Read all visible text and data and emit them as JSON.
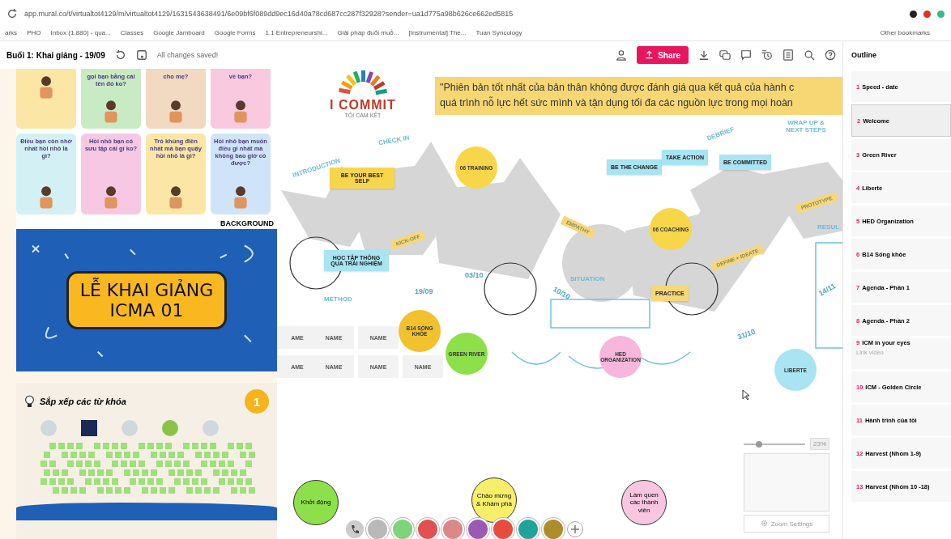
{
  "browser": {
    "url": "app.mural.co/t/virtualtot4129/m/virtualtot4129/1631543638491/6e09bf6f089dd9ec16d40a78cd687cc287f32928?sender=ua1d775a98b626ce662ed5815",
    "bookmarks": [
      "arks",
      "PHO",
      "Inbox (1,880) - qua...",
      "Classes",
      "Google Jamboard",
      "Google Forms",
      "1.1 Entrepreneurshi...",
      "Giải pháp đuổi muỗ...",
      "[Instrumental] The...",
      "Tuan Syncology"
    ],
    "other_bookmarks": "Other bookmarks"
  },
  "toolbar": {
    "title": "Buổi 1: Khai giảng - 19/09",
    "status": "All changes saved!",
    "share": "Share"
  },
  "outline": {
    "title": "Outline",
    "items": [
      {
        "number": "1",
        "label": "Speed - date",
        "selected": false
      },
      {
        "number": "2",
        "label": "Welcome",
        "selected": true
      },
      {
        "number": "3",
        "label": "Green River",
        "selected": false
      },
      {
        "number": "4",
        "label": "Liberte",
        "selected": false
      },
      {
        "number": "5",
        "label": "HED Organization",
        "selected": false
      },
      {
        "number": "6",
        "label": "B14 Sống khỏe",
        "selected": false
      },
      {
        "number": "7",
        "label": "Agenda - Phần 1",
        "selected": false
      },
      {
        "number": "8",
        "label": "Agenda - Phần 2",
        "selected": false
      },
      {
        "number": "9",
        "label": "ICM in your eyes",
        "note": "Link video",
        "selected": false
      },
      {
        "number": "10",
        "label": "ICM - Golden Circle",
        "selected": false
      },
      {
        "number": "11",
        "label": "Hành trình của tôi",
        "selected": false
      },
      {
        "number": "12",
        "label": "Harvest (Nhóm 1-9)",
        "selected": false
      },
      {
        "number": "13",
        "label": "Harvest (Nhóm 10 -18)",
        "selected": false
      }
    ]
  },
  "question_cards": [
    {
      "color": "#fbe6a6"
    },
    {
      "text": "gọi bạn bằng cái tên đó ko?",
      "color": "#c9ebc4"
    },
    {
      "text": "cho mẹ?",
      "color": "#f1d9c2"
    },
    {
      "text": "về bạn?",
      "color": "#f9c9e0"
    },
    {
      "text": "Điều bạn còn nhớ nhất hồi nhỏ là gì?",
      "color": "#d3f1f5"
    },
    {
      "text": "Hồi nhỏ bạn có sưu tập cái gì ko?",
      "color": "#f7c8e4"
    },
    {
      "text": "Trò khùng điên nhất mà bạn quậy hồi nhỏ là gì?",
      "color": "#fbe6a6"
    },
    {
      "text": "Hồi nhỏ bạn muốn điều gì nhất mà không bao giờ có được?",
      "color": "#cfe4f8"
    }
  ],
  "background_label": "BACKGROUND",
  "banner": {
    "line1": "LỄ KHAI GIẢNG",
    "line2": "ICMA 01"
  },
  "keywords_card": {
    "title": "Sắp xếp các từ khóa",
    "badge": "1"
  },
  "canvas": {
    "logo": {
      "name": "I COMMIT",
      "subtitle": "TÔI CAM KẾT"
    },
    "quote": [
      "\"Phiên bản tốt nhất của bản thân không được đánh giá qua kết quả của hành c",
      "quá trình nỗ lực hết sức mình và tận dụng tối đa các nguồn lực trong mọi hoàn"
    ],
    "items": [
      {
        "kind": "label",
        "text": "INTRODUCTION"
      },
      {
        "kind": "label",
        "text": "CHECK IN"
      },
      {
        "kind": "sticky",
        "text": "BE YOUR BEST SELF",
        "color": "#f7d64a"
      },
      {
        "kind": "circle",
        "text": "06 TRAINING",
        "color": "#f7d64a"
      },
      {
        "kind": "sticky",
        "text": "BE THE CHANGE",
        "color": "#a8e4f2"
      },
      {
        "kind": "sticky",
        "text": "TAKE ACTION",
        "color": "#a8e4f2"
      },
      {
        "kind": "sticky",
        "text": "BE COMMITTED",
        "color": "#a8e4f2"
      },
      {
        "kind": "label",
        "text": "DEBRIEF"
      },
      {
        "kind": "label",
        "text": "WRAP UP & NEXT STEPS"
      },
      {
        "kind": "tag",
        "text": "KICK-OFF",
        "color": "#f7d77a"
      },
      {
        "kind": "tag",
        "text": "EMPATHY",
        "color": "#f7d77a"
      },
      {
        "kind": "circle",
        "text": "06 COACHING",
        "color": "#f7d64a"
      },
      {
        "kind": "tag",
        "text": "PROTOTYPE",
        "color": "#f7d77a"
      },
      {
        "kind": "tag",
        "text": "DEFINE + IDEATE",
        "color": "#f7d77a"
      },
      {
        "kind": "label",
        "text": "RESUL"
      },
      {
        "kind": "sticky",
        "text": "HỌC TẬP THÔNG QUA TRẢI NGHIỆM",
        "color": "#a8e4f2"
      },
      {
        "kind": "label",
        "text": "METHOD"
      },
      {
        "kind": "date",
        "text": "19/09"
      },
      {
        "kind": "date",
        "text": "03/10"
      },
      {
        "kind": "label",
        "text": "SITUATION"
      },
      {
        "kind": "date",
        "text": "10/10"
      },
      {
        "kind": "sticky",
        "text": "PRACTICE",
        "color": "#f7d77a"
      },
      {
        "kind": "date",
        "text": "31/10"
      },
      {
        "kind": "date",
        "text": "14/11"
      },
      {
        "kind": "circle",
        "text": "B14 SỐNG KHỎE",
        "color": "#f2c12e"
      },
      {
        "kind": "circle",
        "text": "GREEN RIVER",
        "color": "#8ee04a"
      },
      {
        "kind": "circle",
        "text": "HED ORGANIZATION",
        "color": "#f7b6dc"
      },
      {
        "kind": "circle",
        "text": "LIBERTE",
        "color": "#a8e4f2"
      },
      {
        "kind": "name",
        "text": "AME"
      },
      {
        "kind": "name",
        "text": "NAME"
      },
      {
        "kind": "name",
        "text": "NAME"
      },
      {
        "kind": "name",
        "text": "AME"
      },
      {
        "kind": "name",
        "text": "NAME"
      },
      {
        "kind": "name",
        "text": "NAME"
      },
      {
        "kind": "name",
        "text": "NAME"
      },
      {
        "kind": "bubble",
        "text": "Khởi động",
        "color": "#8ee04a"
      },
      {
        "kind": "bubble",
        "text": "Chào mừng & Khám phá",
        "color": "#f7ef6a"
      },
      {
        "kind": "bubble",
        "text": "Làm quen các thành viên",
        "color": "#f9c6e2"
      }
    ],
    "zoom": {
      "reading": "23%",
      "level": 0.25,
      "settings": "Zoom Settings"
    }
  }
}
